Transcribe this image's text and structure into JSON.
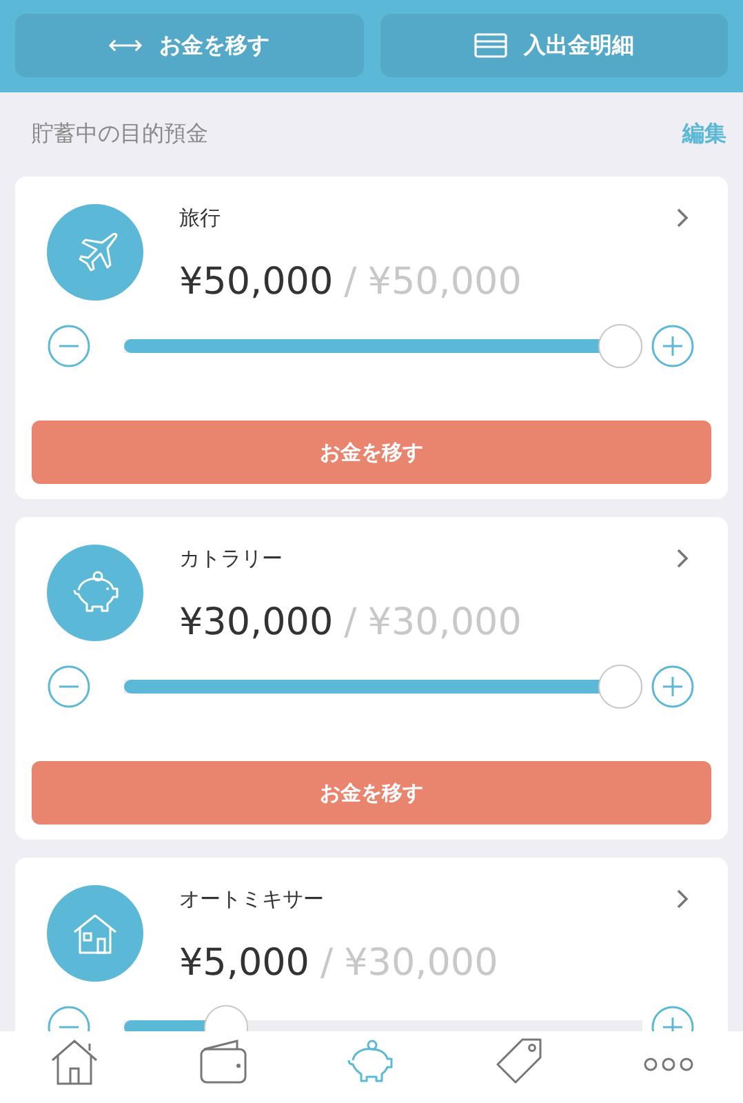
{
  "top_actions": [
    {
      "label": "お金を移す"
    },
    {
      "label": "入出金明細"
    }
  ],
  "section": {
    "title": "貯蓄中の目的預金",
    "edit": "編集"
  },
  "goals": [
    {
      "name": "旅行",
      "saved": "¥50,000",
      "separator": "/",
      "target": "¥50,000",
      "level": 1.0,
      "button": "お金を移す"
    },
    {
      "name": "カトラリー",
      "saved": "¥30,000",
      "separator": "/",
      "target": "¥30,000",
      "level": 1.0,
      "button": "お金を移す"
    },
    {
      "name": "オートミキサー",
      "saved": "¥5,000",
      "separator": "/",
      "target": "¥30,000",
      "level": 0.17
    }
  ],
  "tab_bar": [
    {
      "selected": false
    },
    {
      "selected": false
    },
    {
      "selected": true
    },
    {
      "selected": false
    },
    {
      "selected": false
    }
  ]
}
